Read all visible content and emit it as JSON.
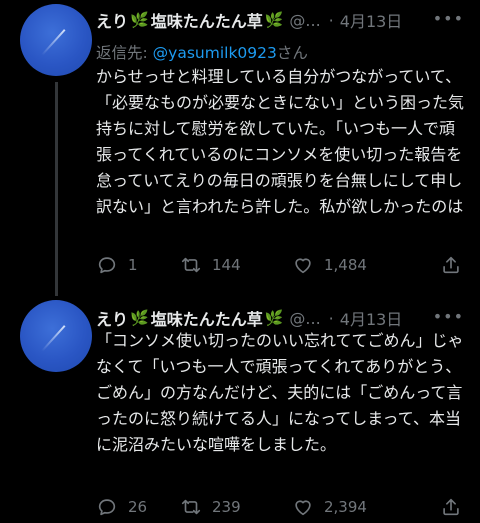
{
  "tweets": [
    {
      "name": "えり",
      "name_suffix": "塩味たんたん草",
      "handle": "@...",
      "date": "4月13日",
      "reply_prefix": "返信先: ",
      "reply_to": "@yasumilk0923",
      "reply_suffix": "さん",
      "text": "からせっせと料理している自分がつながっていて、「必要なものが必要なときにない」という困った気持ちに対して慰労を欲していた。「いつも一人で頑張ってくれているのにコンソメを使い切った報告を怠っていてえりの毎日の頑張りを台無しにして申し訳ない」と言われたら許した。私が欲しかったのは",
      "replies": "1",
      "retweets": "144",
      "likes": "1,484"
    },
    {
      "name": "えり",
      "name_suffix": "塩味たんたん草",
      "handle": "@...",
      "date": "4月13日",
      "text": "「コンソメ使い切ったのいい忘れててごめん」じゃなくて「いつも一人で頑張ってくれてありがとう、ごめん」の方なんだけど、夫的には「ごめんって言ったのに怒り続けてる人」になってしまって、本当に泥沼みたいな喧嘩をしました。",
      "replies": "26",
      "retweets": "239",
      "likes": "2,394"
    }
  ],
  "icons": {
    "reply": "reply-icon",
    "retweet": "retweet-icon",
    "like": "heart-icon",
    "share": "share-icon",
    "leaf": "leaf-icon",
    "more": "more-icon"
  },
  "colors": {
    "background": "#000000",
    "text": "#e7e9ea",
    "muted": "#71767b",
    "link": "#1d9bf0",
    "leaf": "#7cc242"
  }
}
